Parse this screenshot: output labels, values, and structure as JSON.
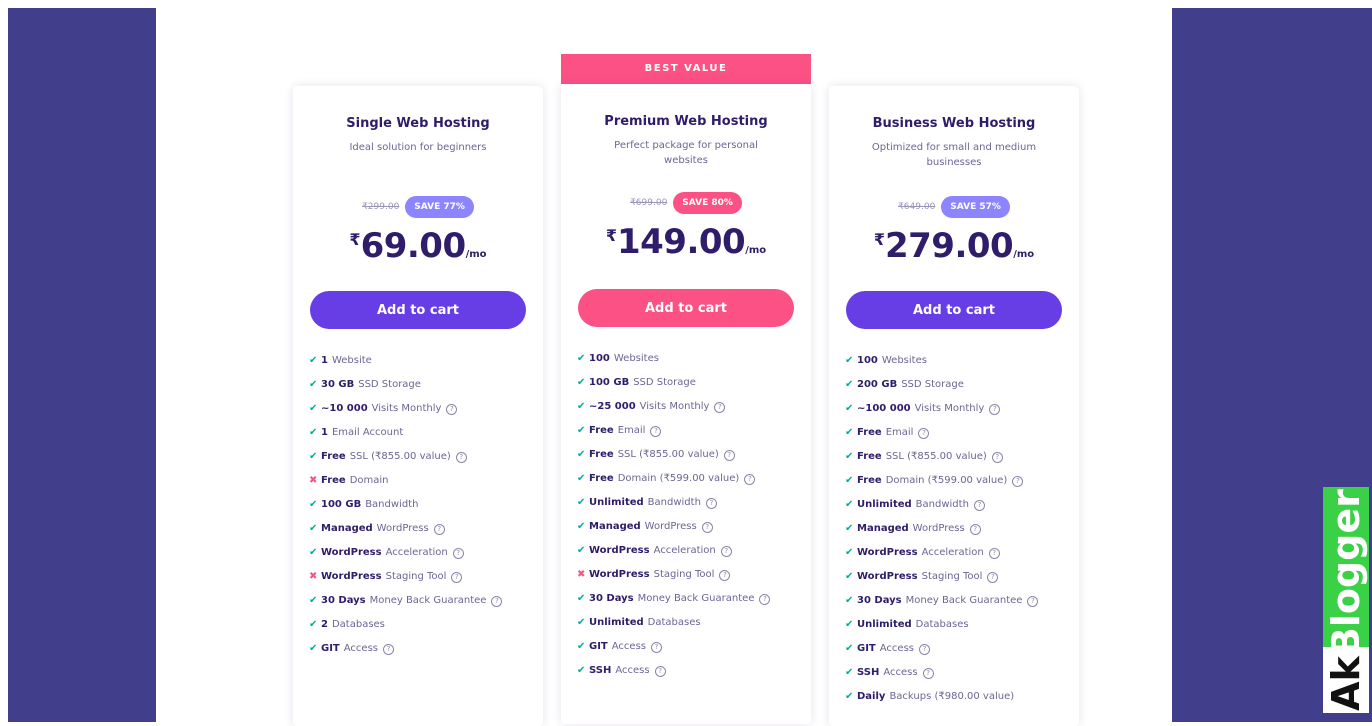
{
  "colors": {
    "side_panel": "#413e8c",
    "primary_purple": "#673de6",
    "accent_pink": "#fc5185",
    "badge_purple": "#8c85ff",
    "heading": "#2f1c6a",
    "check_green": "#00b090"
  },
  "best_value_label": "BEST VALUE",
  "plans": [
    {
      "title": "Single Web Hosting",
      "description": "Ideal solution for beginners",
      "old_price": "₹299.00",
      "save_badge": "SAVE 77%",
      "currency": "₹",
      "price": "69.00",
      "period": "/mo",
      "cta": "Add to cart",
      "features": [
        {
          "icon": "check-icon",
          "bold": "1",
          "text": "Website",
          "info": false
        },
        {
          "icon": "check-icon",
          "bold": "30 GB",
          "text": "SSD Storage",
          "info": false
        },
        {
          "icon": "check-icon",
          "bold": "~10 000",
          "text": "Visits Monthly",
          "info": true
        },
        {
          "icon": "check-icon",
          "bold": "1",
          "text": "Email Account",
          "info": false
        },
        {
          "icon": "check-icon",
          "bold": "Free",
          "text": "SSL (₹855.00 value)",
          "info": true
        },
        {
          "icon": "cross-icon",
          "bold": "Free",
          "text": "Domain",
          "info": false
        },
        {
          "icon": "check-icon",
          "bold": "100 GB",
          "text": "Bandwidth",
          "info": false
        },
        {
          "icon": "check-icon",
          "bold": "Managed",
          "text": "WordPress",
          "info": true
        },
        {
          "icon": "check-icon",
          "bold": "WordPress",
          "text": "Acceleration",
          "info": true
        },
        {
          "icon": "cross-icon",
          "bold": "WordPress",
          "text": "Staging Tool",
          "info": true
        },
        {
          "icon": "check-icon",
          "bold": "30 Days",
          "text": "Money Back Guarantee",
          "info": true
        },
        {
          "icon": "check-icon",
          "bold": "2",
          "text": "Databases",
          "info": false
        },
        {
          "icon": "check-icon",
          "bold": "GIT",
          "text": "Access",
          "info": true
        }
      ]
    },
    {
      "title": "Premium Web Hosting",
      "description": "Perfect package for personal websites",
      "old_price": "₹699.00",
      "save_badge": "SAVE 80%",
      "currency": "₹",
      "price": "149.00",
      "period": "/mo",
      "cta": "Add to cart",
      "features": [
        {
          "icon": "check-icon",
          "bold": "100",
          "text": "Websites",
          "info": false
        },
        {
          "icon": "check-icon",
          "bold": "100 GB",
          "text": "SSD Storage",
          "info": false
        },
        {
          "icon": "check-icon",
          "bold": "~25 000",
          "text": "Visits Monthly",
          "info": true
        },
        {
          "icon": "check-icon",
          "bold": "Free",
          "text": "Email",
          "info": true
        },
        {
          "icon": "check-icon",
          "bold": "Free",
          "text": "SSL (₹855.00 value)",
          "info": true
        },
        {
          "icon": "check-icon",
          "bold": "Free",
          "text": "Domain (₹599.00 value)",
          "info": true
        },
        {
          "icon": "check-icon",
          "bold": "Unlimited",
          "text": "Bandwidth",
          "info": true
        },
        {
          "icon": "check-icon",
          "bold": "Managed",
          "text": "WordPress",
          "info": true
        },
        {
          "icon": "check-icon",
          "bold": "WordPress",
          "text": "Acceleration",
          "info": true
        },
        {
          "icon": "cross-icon",
          "bold": "WordPress",
          "text": "Staging Tool",
          "info": true
        },
        {
          "icon": "check-icon",
          "bold": "30 Days",
          "text": "Money Back Guarantee",
          "info": true
        },
        {
          "icon": "check-icon",
          "bold": "Unlimited",
          "text": "Databases",
          "info": false
        },
        {
          "icon": "check-icon",
          "bold": "GIT",
          "text": "Access",
          "info": true
        },
        {
          "icon": "check-icon",
          "bold": "SSH",
          "text": "Access",
          "info": true
        }
      ]
    },
    {
      "title": "Business Web Hosting",
      "description": "Optimized for small and medium businesses",
      "old_price": "₹649.00",
      "save_badge": "SAVE 57%",
      "currency": "₹",
      "price": "279.00",
      "period": "/mo",
      "cta": "Add to cart",
      "features": [
        {
          "icon": "check-icon",
          "bold": "100",
          "text": "Websites",
          "info": false
        },
        {
          "icon": "check-icon",
          "bold": "200 GB",
          "text": "SSD Storage",
          "info": false
        },
        {
          "icon": "check-icon",
          "bold": "~100 000",
          "text": "Visits Monthly",
          "info": true
        },
        {
          "icon": "check-icon",
          "bold": "Free",
          "text": "Email",
          "info": true
        },
        {
          "icon": "check-icon",
          "bold": "Free",
          "text": "SSL (₹855.00 value)",
          "info": true
        },
        {
          "icon": "check-icon",
          "bold": "Free",
          "text": "Domain (₹599.00 value)",
          "info": true
        },
        {
          "icon": "check-icon",
          "bold": "Unlimited",
          "text": "Bandwidth",
          "info": true
        },
        {
          "icon": "check-icon",
          "bold": "Managed",
          "text": "WordPress",
          "info": true
        },
        {
          "icon": "check-icon",
          "bold": "WordPress",
          "text": "Acceleration",
          "info": true
        },
        {
          "icon": "check-icon",
          "bold": "WordPress",
          "text": "Staging Tool",
          "info": true
        },
        {
          "icon": "check-icon",
          "bold": "30 Days",
          "text": "Money Back Guarantee",
          "info": true
        },
        {
          "icon": "check-icon",
          "bold": "Unlimited",
          "text": "Databases",
          "info": false
        },
        {
          "icon": "check-icon",
          "bold": "GIT",
          "text": "Access",
          "info": true
        },
        {
          "icon": "check-icon",
          "bold": "SSH",
          "text": "Access",
          "info": true
        },
        {
          "icon": "check-icon",
          "bold": "Daily",
          "text": "Backups (₹980.00 value)",
          "info": false
        }
      ]
    }
  ],
  "watermark": {
    "part1": "Ak",
    "part2": "Blogger"
  }
}
